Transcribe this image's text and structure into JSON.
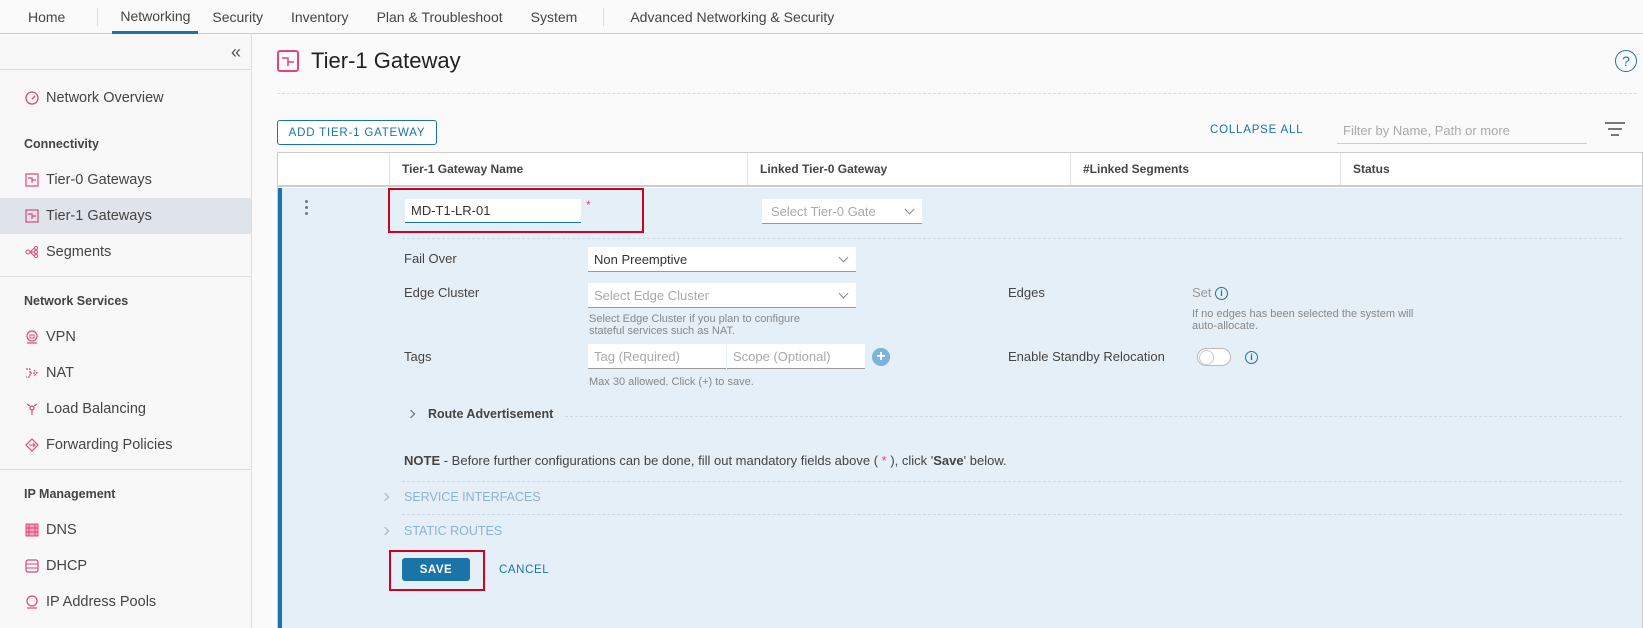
{
  "topnav": {
    "tabs": [
      {
        "label": "Home"
      },
      {
        "label": "Networking",
        "active": true
      },
      {
        "label": "Security"
      },
      {
        "label": "Inventory"
      },
      {
        "label": "Plan & Troubleshoot"
      },
      {
        "label": "System"
      },
      {
        "label": "Advanced Networking & Security"
      }
    ]
  },
  "sidebar": {
    "collapse_icon": "«",
    "overview": {
      "label": "Network Overview",
      "icon": "dashboard-icon"
    },
    "sections": [
      {
        "title": "Connectivity",
        "items": [
          {
            "label": "Tier-0 Gateways",
            "icon": "gateway-icon"
          },
          {
            "label": "Tier-1 Gateways",
            "icon": "gateway-icon",
            "active": true
          },
          {
            "label": "Segments",
            "icon": "segments-icon"
          }
        ]
      },
      {
        "title": "Network Services",
        "items": [
          {
            "label": "VPN",
            "icon": "vpn-icon"
          },
          {
            "label": "NAT",
            "icon": "nat-icon"
          },
          {
            "label": "Load Balancing",
            "icon": "load-balancer-icon"
          },
          {
            "label": "Forwarding Policies",
            "icon": "forwarding-icon"
          }
        ]
      },
      {
        "title": "IP Management",
        "items": [
          {
            "label": "DNS",
            "icon": "dns-icon"
          },
          {
            "label": "DHCP",
            "icon": "dhcp-icon"
          },
          {
            "label": "IP Address Pools",
            "icon": "ip-pool-icon"
          }
        ]
      }
    ]
  },
  "page": {
    "title": "Tier-1 Gateway",
    "help_icon": "?",
    "add_button": "ADD TIER-1 GATEWAY",
    "collapse_all": "COLLAPSE ALL",
    "filter_placeholder": "Filter by Name, Path or more"
  },
  "grid": {
    "columns": [
      "Tier-1 Gateway Name",
      "Linked Tier-0 Gateway",
      "#Linked Segments",
      "Status"
    ],
    "row": {
      "name_value": "MD-T1-LR-01",
      "required_mark": "*",
      "tier0_placeholder": "Select Tier-0 Gate",
      "fail_over": {
        "label": "Fail Over",
        "value": "Non Preemptive"
      },
      "edge_cluster": {
        "label": "Edge Cluster",
        "placeholder": "Select Edge Cluster",
        "hint_line1": "Select Edge Cluster if you plan to configure",
        "hint_line2": "stateful services such as NAT."
      },
      "tags": {
        "label": "Tags",
        "tag_placeholder": "Tag (Required)",
        "scope_placeholder": "Scope (Optional)",
        "hint": "Max 30 allowed. Click (+) to save.",
        "add_icon": "+"
      },
      "edges": {
        "label": "Edges",
        "value": "Set",
        "hint_line1": "If no edges has been selected the system will",
        "hint_line2": "auto-allocate."
      },
      "standby": {
        "label": "Enable Standby Relocation",
        "enabled": false
      },
      "info_icon": "i",
      "route_advertisement": "Route Advertisement",
      "note_prefix": "NOTE",
      "note_text": " - Before further configurations can be done, fill out mandatory fields above ( ",
      "note_star": "*",
      "note_mid": " ), click '",
      "note_save": "Save",
      "note_end": "' below.",
      "service_interfaces": "SERVICE INTERFACES",
      "static_routes": "STATIC ROUTES",
      "save": "SAVE",
      "cancel": "CANCEL"
    }
  }
}
